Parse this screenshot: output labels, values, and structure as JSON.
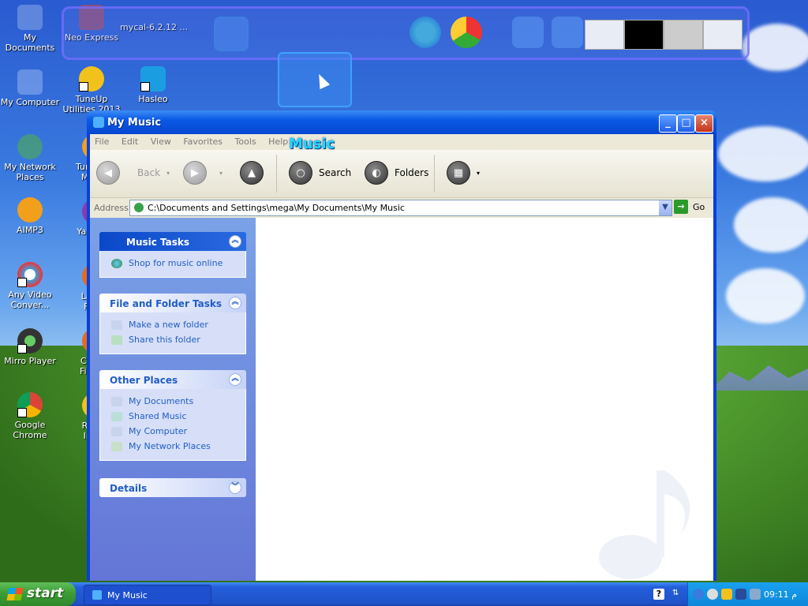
{
  "desktop": {
    "icons": [
      {
        "label": "My Documents"
      },
      {
        "label": "Neo Express"
      },
      {
        "label": "mycal-6.2.12 ..."
      },
      {
        "label": "My Computer"
      },
      {
        "label": "TuneUp Utilities 2013"
      },
      {
        "label": "Hasleo"
      },
      {
        "label": "My Network Places"
      },
      {
        "label": "TuneUp Main"
      },
      {
        "label": "AIMP3"
      },
      {
        "label": "Ya Mes"
      },
      {
        "label": "Any Video Conver..."
      },
      {
        "label": "Laun Fire"
      },
      {
        "label": "Mirro Player"
      },
      {
        "label": "Confi Fire S"
      },
      {
        "label": "Google Chrome"
      },
      {
        "label": "Righ Ima"
      }
    ]
  },
  "window": {
    "title": "My Music",
    "logo_text": "Music",
    "menu": [
      "File",
      "Edit",
      "View",
      "Favorites",
      "Tools",
      "Help"
    ],
    "toolbar": {
      "back_label": "Back",
      "search_label": "Search",
      "folders_label": "Folders"
    },
    "address": {
      "label": "Address",
      "value": "C:\\Documents and Settings\\mega\\My Documents\\My Music",
      "go_label": "Go"
    },
    "panels": {
      "music_tasks": {
        "title": "Music Tasks",
        "items": [
          "Shop for music online"
        ]
      },
      "file_folder_tasks": {
        "title": "File and Folder Tasks",
        "items": [
          "Make a new folder",
          "Share this folder"
        ]
      },
      "other_places": {
        "title": "Other Places",
        "items": [
          "My Documents",
          "Shared Music",
          "My Computer",
          "My Network Places"
        ]
      },
      "details": {
        "title": "Details"
      }
    }
  },
  "taskbar": {
    "start_label": "start",
    "task_label": "My Music",
    "clock": "09:11 م"
  },
  "colors": {
    "accent": "#0a48c8",
    "link": "#215dc6",
    "start_green": "#3c9d35"
  }
}
